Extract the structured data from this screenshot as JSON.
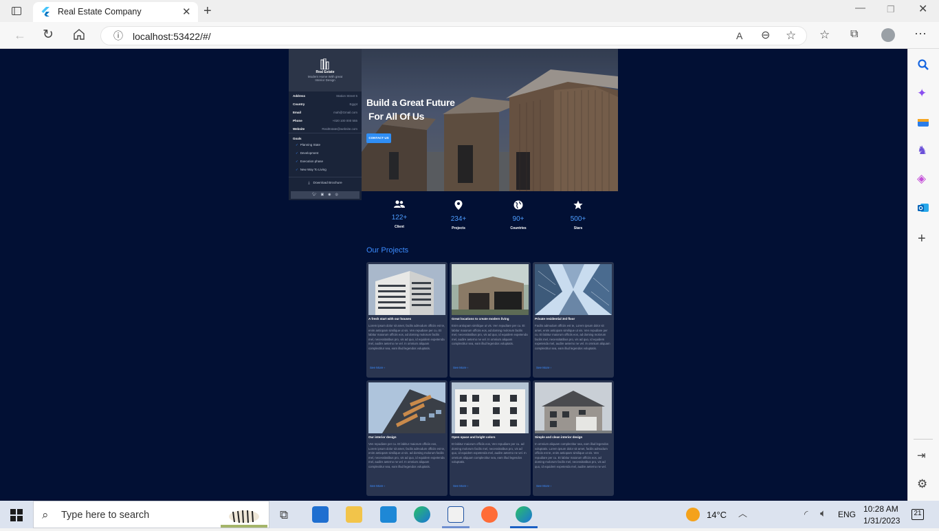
{
  "browser": {
    "tab_title": "Real Estate Company",
    "url": "localhost:53422/#/"
  },
  "sidebar": {
    "brand_title": "Real Estate",
    "brand_subtitle": "Modern Home With great Interior Design",
    "info": [
      {
        "key": "Address",
        "value": "Station Street 5"
      },
      {
        "key": "Country",
        "value": "Egypt"
      },
      {
        "key": "Email",
        "value": "mah@Gmail.com"
      },
      {
        "key": "Phone",
        "value": "+020 100 000 555"
      },
      {
        "key": "Website",
        "value": "RealEstate@website.com"
      }
    ],
    "goals_title": "Goals",
    "goals": [
      "Planning State",
      "Development",
      "Execution phase",
      "New Way To Living"
    ],
    "download_label": "Download Brochure"
  },
  "hero": {
    "line1": "Build a Great Future",
    "line2": "For All Of Us",
    "cta": "CONTACT US"
  },
  "stats": [
    {
      "icon": "people-icon",
      "value": "122+",
      "label": "Client"
    },
    {
      "icon": "location-pin-icon",
      "value": "234+",
      "label": "Projects"
    },
    {
      "icon": "globe-icon",
      "value": "90+",
      "label": "Countries"
    },
    {
      "icon": "star-icon",
      "value": "500+",
      "label": "Stars"
    }
  ],
  "projects_title": "Our Projects",
  "projects": [
    {
      "title": "A fresh start with our houses",
      "text": "Lorem ipsum dolor sit amet, facilis admodum officiis est te, enim antiopam similique ut vis. Ven repudiare per cu. Et labitur maiorum officiis eos, ad doming molorum facilis mel, necessitatibus pro, vis ad quo, id equidem expetenda mel, audire aeterno ne vel. In omnium aliquam complectitur sea, eam illud legendos voluptatis.",
      "more": "See More"
    },
    {
      "title": "Great locations to create modern living",
      "text": "Enim antiopam similique ut vis. Ven repudiare per cu. Et labitur maiorum officiis eos, ad doming molorum facilis mel, necessitatibus pro, vis ad quo, id equidem expetenda mel, audire aeterno ne vel. In omnium aliquam complectitur sea, eam illud legendos voluptatis.",
      "more": "See More"
    },
    {
      "title": "Private residential 3rd floor",
      "text": "Facilis admodum officiis est te, Lorem ipsum dolor sit amet, enim antiopam similique ut vis. Ven repudiare per cu. Et labitur maiorum officiis eos, ad doming molorum facilis mel, necessitatibus pro, vis ad quo, id equidem expetenda mel, audire aeterno ne vel. In omnium aliquam complectitur sea, eam illud legendos voluptatis.",
      "more": "See More"
    },
    {
      "title": "Our interior design",
      "text": "Ven repudiare per cu. Et labitur maiorum officiis eos, Lorem ipsum dolor sit amet, facilis admodum officiis est te, enim antiopam similique ut vis. ad doming molorum facilis mel, necessitatibus pro, vis ad quo, id equidem expetenda mel, audire aeterno ne vel. In omnium aliquam complectitur sea, eam illud legendos voluptatis.",
      "more": "See More"
    },
    {
      "title": "Open space and bright colors",
      "text": "Et labitur maiorum officiis eos, Ven repudiare per cu. ad doming molorum facilis mel, necessitatibus pro, vis ad quo, id equidem expetenda mel, audire aeterno ne vel. In omnium aliquam complectitur sea, eam illud legendos voluptatis.",
      "more": "See More"
    },
    {
      "title": "Simple and clean interior design",
      "text": "In omnium aliquam complectitur sea, eam illud legendos voluptatis. Lorem ipsum dolor sit amet, facilis admodum officiis est te, enim antiopam similique ut vis. Ven repudiare per cu. Et labitur maiorum officiis eos, ad doming molorum facilis mel, necessitatibus pro, vis ad quo, id equidem expetenda mel, audire aeterno ne vel.",
      "more": "See More"
    }
  ],
  "taskbar": {
    "search_placeholder": "Type here to search",
    "weather": "14°C",
    "language": "ENG",
    "time": "10:28 AM",
    "date": "1/31/2023",
    "notifications": "21"
  },
  "colors": {
    "page_bg": "#021034",
    "accent": "#3b8cff",
    "card_bg": "#2a3550"
  }
}
